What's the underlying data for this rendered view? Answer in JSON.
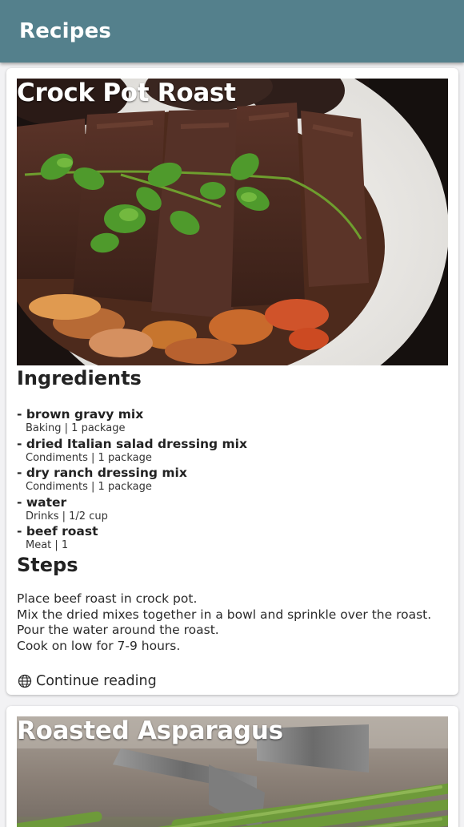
{
  "app": {
    "title": "Recipes"
  },
  "recipes": [
    {
      "title": "Crock Pot Roast",
      "image": "roast-image",
      "ingredients_heading": "Ingredients",
      "ingredients": [
        {
          "name": "- brown gravy mix",
          "meta": "Baking | 1 package"
        },
        {
          "name": "- dried Italian salad dressing mix",
          "meta": "Condiments | 1 package"
        },
        {
          "name": "- dry ranch dressing mix",
          "meta": "Condiments | 1 package"
        },
        {
          "name": "- water",
          "meta": "Drinks | 1/2 cup"
        },
        {
          "name": "- beef roast",
          "meta": "Meat | 1"
        }
      ],
      "steps_heading": "Steps",
      "steps": [
        "Place beef roast in crock pot.",
        "Mix the dried mixes together in a bowl and sprinkle over the roast.",
        "Pour the water around the roast.",
        "Cook on low for 7-9 hours."
      ],
      "continue_label": "Continue reading",
      "continue_icon": "globe-icon"
    },
    {
      "title": "Roasted Asparagus",
      "image": "asparagus-image"
    }
  ]
}
